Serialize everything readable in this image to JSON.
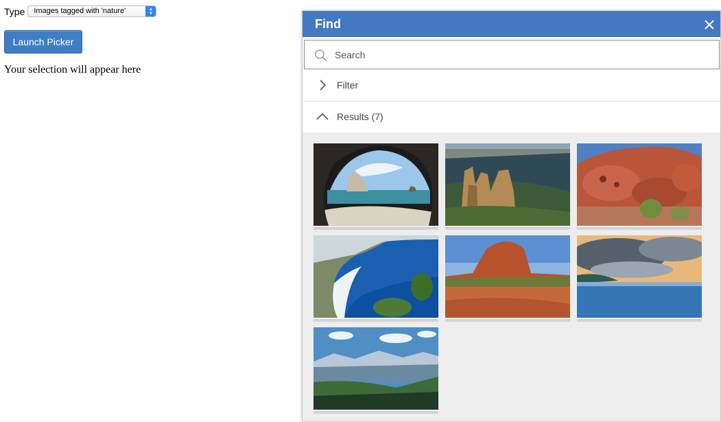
{
  "host": {
    "type_label": "Type",
    "type_value": "Images tagged with 'nature'",
    "launch_label": "Launch Picker",
    "selection_text": "Your selection will appear here"
  },
  "picker": {
    "title": "Find",
    "close_icon": "close-icon",
    "search_placeholder": "Search",
    "search_value": "",
    "filter_label": "Filter",
    "results_label": "Results (7)",
    "accent_color": "#4279c0",
    "results": [
      {
        "name": "sea-cave-arch",
        "alt": "Sea cave arch framing a rock stack and beach"
      },
      {
        "name": "rock-pinnacles-valley",
        "alt": "Sandstone rock pinnacles above a forested valley"
      },
      {
        "name": "red-boulders",
        "alt": "Weathered red boulders with desert shrubs"
      },
      {
        "name": "blue-bay-cliffs",
        "alt": "Turquoise bay beneath cliffs with a white beach"
      },
      {
        "name": "red-dome-outback",
        "alt": "Red rock dome over outback scrubland"
      },
      {
        "name": "ocean-clouds-sunset",
        "alt": "Ocean with dramatic clouds at sunset"
      },
      {
        "name": "mountain-lake-valley",
        "alt": "Alpine valley with a lake and mountain range"
      }
    ]
  }
}
